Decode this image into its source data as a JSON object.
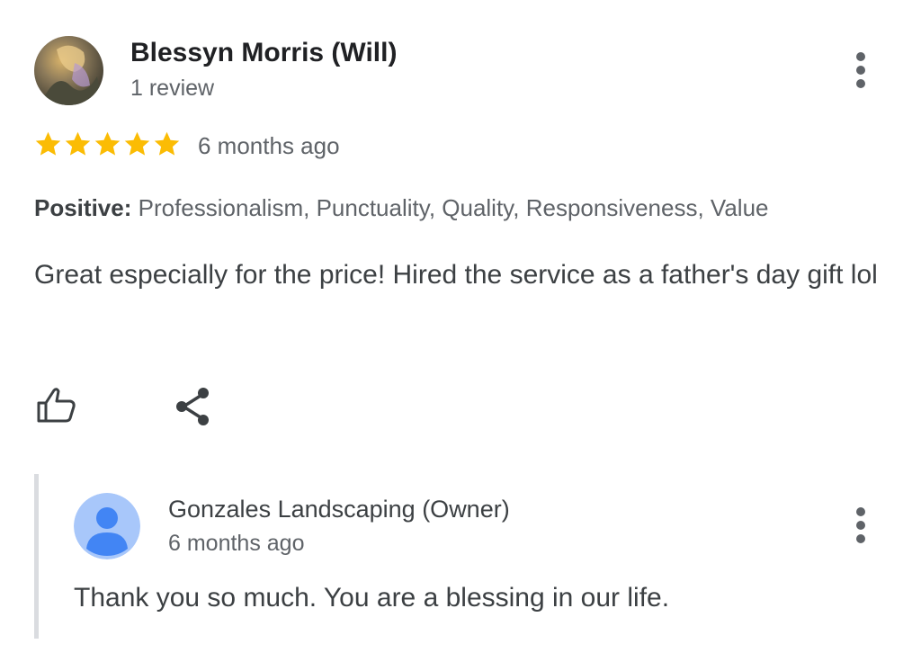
{
  "review": {
    "author_name": "Blessyn Morris (Will)",
    "author_review_count": "1 review",
    "rating": 5,
    "rating_max": 5,
    "time": "6 months ago",
    "attributes_label": "Positive:",
    "attributes_values": "Professionalism, Punctuality, Quality, Responsiveness, Value",
    "text": "Great especially for the price! Hired the service as a father's day gift lol",
    "actions": [
      "thumbs-up-icon",
      "share-icon"
    ],
    "menu_icon": "more-vert-icon"
  },
  "owner_reply": {
    "author_name": "Gonzales Landscaping (Owner)",
    "time": "6 months ago",
    "text": "Thank you so much. You are a blessing in our life.",
    "avatar_icon": "person-icon",
    "menu_icon": "more-vert-icon"
  },
  "colors": {
    "star": "#fbbc04",
    "secondary_text": "#5f6368",
    "primary_text": "#202124",
    "reply_bar": "#dadce0",
    "owner_avatar_bg": "#a8c7fa",
    "owner_avatar_fg": "#4285f4"
  }
}
